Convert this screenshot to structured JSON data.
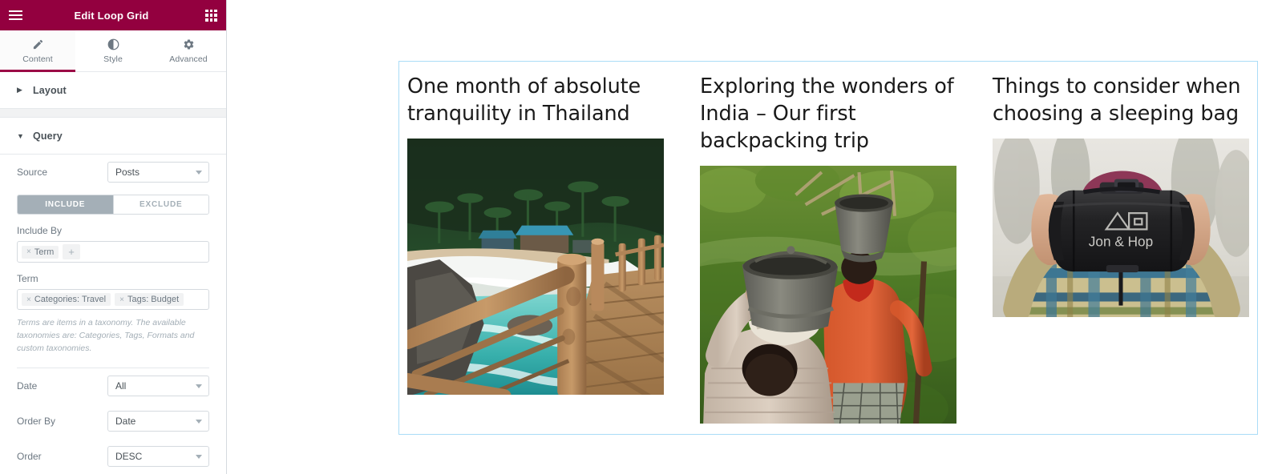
{
  "panel": {
    "header": {
      "title": "Edit Loop Grid",
      "menu_icon": "hamburger-icon",
      "apps_icon": "grid-apps-icon",
      "bg_color": "#93003f"
    },
    "tabs": [
      {
        "label": "Content",
        "icon": "pencil-icon",
        "active": true
      },
      {
        "label": "Style",
        "icon": "contrast-icon",
        "active": false
      },
      {
        "label": "Advanced",
        "icon": "gear-icon",
        "active": false
      }
    ],
    "sections": [
      {
        "title": "Layout",
        "expanded": false,
        "caret": "▶"
      },
      {
        "title": "Query",
        "expanded": true,
        "caret": "▼"
      }
    ],
    "query": {
      "source": {
        "label": "Source",
        "value": "Posts"
      },
      "toggle": {
        "include": "INCLUDE",
        "exclude": "EXCLUDE",
        "active": "INCLUDE"
      },
      "include_by": {
        "label": "Include By",
        "chips": [
          {
            "label": "Term",
            "remove": "×"
          }
        ],
        "add": "+"
      },
      "term": {
        "label": "Term",
        "chips": [
          {
            "label": "Categories: Travel",
            "remove": "×"
          },
          {
            "label": "Tags: Budget",
            "remove": "×"
          }
        ],
        "help": "Terms are items in a taxonomy. The available taxonomies are: Categories, Tags, Formats and custom taxonomies."
      },
      "date": {
        "label": "Date",
        "value": "All"
      },
      "order_by": {
        "label": "Order By",
        "value": "Date"
      },
      "order": {
        "label": "Order",
        "value": "DESC"
      }
    },
    "collapse_handle": {
      "icon": "chevron-left-icon",
      "glyph": "❮"
    }
  },
  "canvas": {
    "loop_grid": {
      "border_color": "#aadcf7",
      "posts": [
        {
          "title": "One month of absolute tranquility in Thailand",
          "image_alt": "wooden-bridge-tropical-beach"
        },
        {
          "title": "Exploring the wonders of India – Our first backpacking trip",
          "image_alt": "women-carrying-buckets-green-hillside"
        },
        {
          "title": "Things to consider when choosing a sleeping bag",
          "image_alt": "person-holding-black-sleeping-bag",
          "image_text": "Jon & Hop"
        }
      ]
    }
  }
}
